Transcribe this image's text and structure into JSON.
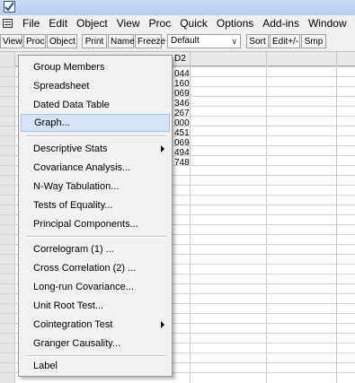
{
  "menubar": {
    "items": [
      "File",
      "Edit",
      "Object",
      "View",
      "Proc",
      "Quick",
      "Options",
      "Add-ins",
      "Window"
    ]
  },
  "toolbar": {
    "view": "View",
    "proc": "Proc",
    "object": "Object",
    "print": "Print",
    "name": "Name",
    "freeze": "Freeze",
    "default_select": "Default",
    "sort": "Sort",
    "edit": "Edit+/-",
    "smpl": "Smp"
  },
  "sheet": {
    "column_header": "D2",
    "values": [
      "044",
      "160",
      "069",
      "346",
      "267",
      "000",
      "451",
      "069",
      "494",
      "748"
    ]
  },
  "proc_menu": {
    "items": [
      "Group Members",
      "Spreadsheet",
      "Dated Data Table",
      "Graph...",
      "Descriptive Stats",
      "Covariance Analysis...",
      "N-Way Tabulation...",
      "Tests of Equality...",
      "Principal Components...",
      "Correlogram (1) ...",
      "Cross Correlation (2) ...",
      "Long-run Covariance...",
      "Unit Root Test...",
      "Cointegration Test",
      "Granger Causality...",
      "Label"
    ]
  }
}
